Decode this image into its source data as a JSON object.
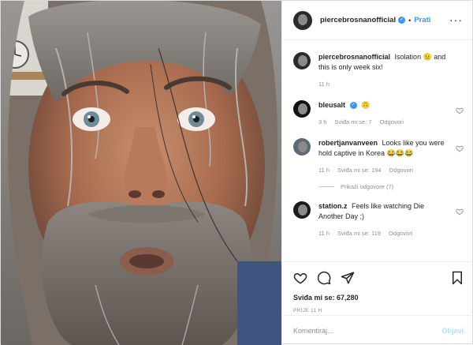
{
  "header": {
    "username": "piercebrosnanofficial",
    "follow_label": "Prati",
    "separator": "•",
    "more_icon": "more-horizontal-icon"
  },
  "caption": {
    "username": "piercebrosnanofficial",
    "text": "Isolation 😐 and this is only week six!",
    "time": "11 h"
  },
  "comments": [
    {
      "username": "bleusalt",
      "text": "🙃",
      "time": "3 h",
      "likes": "Sviđa mi se: 7",
      "reply": "Odgovori"
    },
    {
      "username": "robertjanvanveen",
      "text": "Looks like you were hold captive in Korea 😂😂😂",
      "time": "11 h",
      "likes": "Sviđa mi se: 194",
      "reply": "Odgovori",
      "show_replies": "Prikaži odgovore (7)"
    },
    {
      "username": "station.z",
      "text": "Feels like watching Die Another Day ;)",
      "time": "11 h",
      "likes": "Sviđa mi se: 119",
      "reply": "Odgovori"
    }
  ],
  "actions": {
    "likes": "Sviđa mi se: 67,280",
    "posted": "PRIJE 11 H"
  },
  "comment_input": {
    "placeholder": "Komentiraj...",
    "post_label": "Objavi"
  },
  "colors": {
    "accent": "#3897f0",
    "muted": "#8e8e8e",
    "post_disabled": "#b2dffc"
  }
}
